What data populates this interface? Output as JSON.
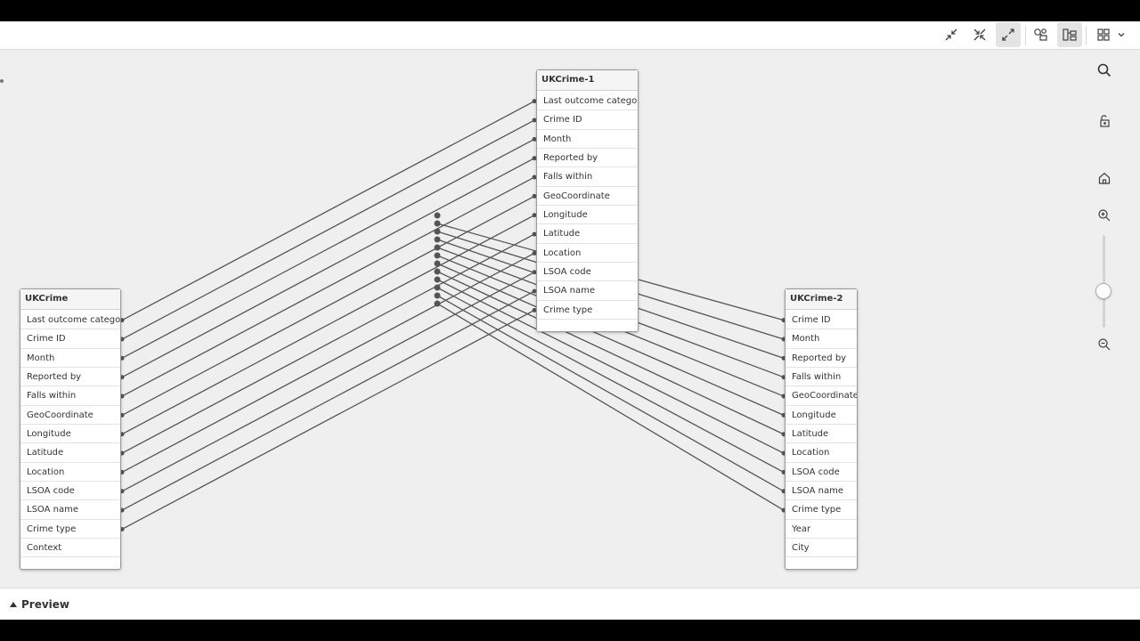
{
  "toolbar": {
    "buttons": [
      {
        "name": "collapse-all-button",
        "icon": "collapse-icon"
      },
      {
        "name": "show-linked-fields-button",
        "icon": "shrink-icon"
      },
      {
        "name": "expand-all-button",
        "icon": "expand-icon",
        "active": true
      },
      {
        "name": "internal-view-button",
        "icon": "internal-view-icon"
      },
      {
        "name": "source-view-button",
        "icon": "source-view-icon",
        "active": true
      },
      {
        "name": "layout-menu-button",
        "icon": "grid-icon"
      }
    ]
  },
  "tables": [
    {
      "id": "ukcrime",
      "title": "UKCrime",
      "fields": [
        "Last outcome category",
        "Crime ID",
        "Month",
        "Reported by",
        "Falls within",
        "GeoCoordinate",
        "Longitude",
        "Latitude",
        "Location",
        "LSOA code",
        "LSOA name",
        "Crime type",
        "Context"
      ]
    },
    {
      "id": "ukcrime-1",
      "title": "UKCrime-1",
      "fields": [
        "Last outcome category",
        "Crime ID",
        "Month",
        "Reported by",
        "Falls within",
        "GeoCoordinate",
        "Longitude",
        "Latitude",
        "Location",
        "LSOA code",
        "LSOA name",
        "Crime type"
      ]
    },
    {
      "id": "ukcrime-2",
      "title": "UKCrime-2",
      "fields": [
        "Crime ID",
        "Month",
        "Reported by",
        "Falls within",
        "GeoCoordinate",
        "Longitude",
        "Latitude",
        "Location",
        "LSOA code",
        "LSOA name",
        "Crime type",
        "Year",
        "City"
      ]
    }
  ],
  "right_tools": {
    "search": "search-icon",
    "lock": "unlock-icon",
    "home": "home-icon",
    "zoom_in": "zoom-in-icon",
    "zoom_out": "zoom-out-icon"
  },
  "preview": {
    "label": "Preview",
    "icon": "triangle-up-icon"
  },
  "colors": {
    "link": "#555555",
    "canvas": "#efefef"
  }
}
